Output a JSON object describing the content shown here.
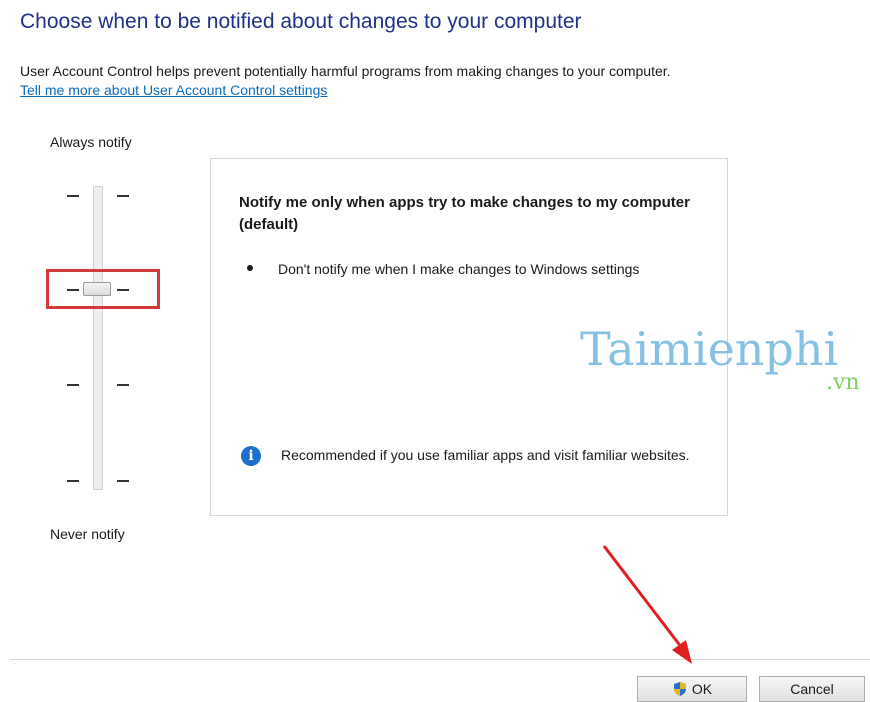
{
  "header": {
    "title": "Choose when to be notified about changes to your computer",
    "description": "User Account Control helps prevent potentially harmful programs from making changes to your computer.",
    "help_link": "Tell me more about User Account Control settings"
  },
  "slider": {
    "top_label": "Always notify",
    "bottom_label": "Never notify",
    "levels": 4,
    "selected_level": 3
  },
  "panel": {
    "heading": "Notify me only when apps try to make changes to my computer (default)",
    "bullet": "Don't notify me when I make changes to Windows settings",
    "recommendation": "Recommended if you use familiar apps and visit familiar websites.",
    "info_icon": "i"
  },
  "watermark": {
    "brand": "Taimienphi",
    "tld": ".vn"
  },
  "buttons": {
    "ok": "OK",
    "cancel": "Cancel"
  },
  "colors": {
    "title": "#1e3287",
    "link": "#0a6bbd",
    "highlight": "#d33a3a",
    "info": "#1e6fc9"
  },
  "icons": {
    "ok_button": "uac-shield-icon",
    "panel": "info-icon"
  }
}
